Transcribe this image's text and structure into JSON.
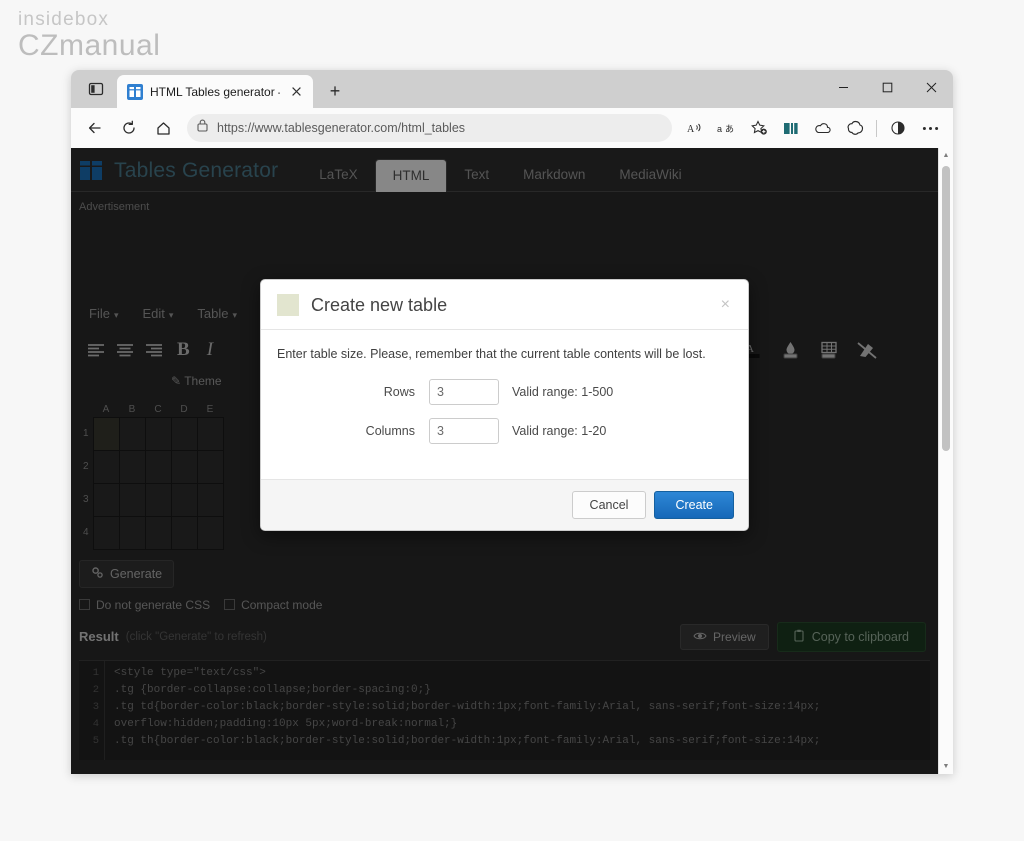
{
  "watermark": {
    "line1": "insidebox",
    "line2": "CZmanual"
  },
  "browser": {
    "tab": {
      "title": "HTML Tables generator – TablesG",
      "favicon_icon": "tables-favicon",
      "close_icon": "close-icon"
    },
    "tab_actions_icon": "tab-actions-icon",
    "newtab_label": "+",
    "window_controls": {
      "minimize": "─",
      "maximize": "☐",
      "close": "×"
    },
    "nav": {
      "back": "←",
      "reload": "↻",
      "home": "⌂"
    },
    "omnibox": {
      "lock_icon": "lock-icon",
      "url": "https://www.tablesgenerator.com/html_tables"
    },
    "toolbar_icons": [
      {
        "name": "read-aloud-icon",
        "glyph": "A"
      },
      {
        "name": "translate-icon",
        "glyph": "aあ"
      },
      {
        "name": "add-favorite-icon",
        "glyph": "☆"
      },
      {
        "name": "split-screen-icon",
        "glyph": "▧"
      },
      {
        "name": "onedrive-icon",
        "glyph": "☁"
      },
      {
        "name": "copilot-icon",
        "glyph": "✿"
      },
      {
        "name": "browser-essentials-icon",
        "glyph": "◑"
      },
      {
        "name": "settings-more-icon",
        "glyph": "•••"
      }
    ]
  },
  "site": {
    "logo_text": "Tables Generator",
    "tabs": [
      {
        "label": "LaTeX",
        "active": false
      },
      {
        "label": "HTML",
        "active": true
      },
      {
        "label": "Text",
        "active": false
      },
      {
        "label": "Markdown",
        "active": false
      },
      {
        "label": "MediaWiki",
        "active": false
      }
    ],
    "ad_label": "Advertisement"
  },
  "app": {
    "menus": [
      {
        "label": "File"
      },
      {
        "label": "Edit"
      },
      {
        "label": "Table"
      }
    ],
    "menu_caret": "▾",
    "toolbar": {
      "align_left_icon": "align-left-icon",
      "align_center_icon": "align-center-icon",
      "align_right_icon": "align-right-icon",
      "bold_label": "B",
      "italic_label": "I",
      "text_color_icon": "text-color-icon",
      "fill_color_icon": "fill-color-icon",
      "border_color_icon": "border-color-icon",
      "clear_format_icon": "clear-formatting-icon"
    },
    "theme_label": "Theme",
    "theme_icon": "theme-brush-icon",
    "grid": {
      "columns": [
        "A",
        "B",
        "C",
        "D",
        "E"
      ],
      "rows": [
        "1",
        "2",
        "3",
        "4"
      ],
      "selected_cell": "A1"
    },
    "generate_label": "Generate",
    "generate_icon": "gears-icon",
    "checkboxes": [
      {
        "label": "Do not generate CSS",
        "checked": false
      },
      {
        "label": "Compact mode",
        "checked": false
      }
    ],
    "result_label": "Result",
    "result_hint": "(click \"Generate\" to refresh)",
    "preview_label": "Preview",
    "preview_icon": "eye-icon",
    "copy_label": "Copy to clipboard",
    "copy_icon": "clipboard-icon",
    "code": {
      "line_numbers": [
        "1",
        "2",
        "3",
        "4",
        "5"
      ],
      "lines": [
        "<style type=\"text/css\">",
        ".tg  {border-collapse:collapse;border-spacing:0;}",
        ".tg td{border-color:black;border-style:solid;border-width:1px;font-family:Arial, sans-serif;font-size:14px;",
        "  overflow:hidden;padding:10px 5px;word-break:normal;}",
        ".tg th{border-color:black;border-style:solid;border-width:1px;font-family:Arial, sans-serif;font-size:14px;"
      ]
    }
  },
  "modal": {
    "title": "Create new table",
    "close_label": "×",
    "description": "Enter table size. Please, remember that the current table contents will be lost.",
    "fields": [
      {
        "label": "Rows",
        "value": "3",
        "hint": "Valid range: 1-500"
      },
      {
        "label": "Columns",
        "value": "3",
        "hint": "Valid range: 1-20"
      }
    ],
    "cancel_label": "Cancel",
    "create_label": "Create"
  },
  "colors": {
    "accent_blue": "#1668b8",
    "copy_green": "#1d3b22",
    "logo_blue": "#4a7a8c"
  }
}
